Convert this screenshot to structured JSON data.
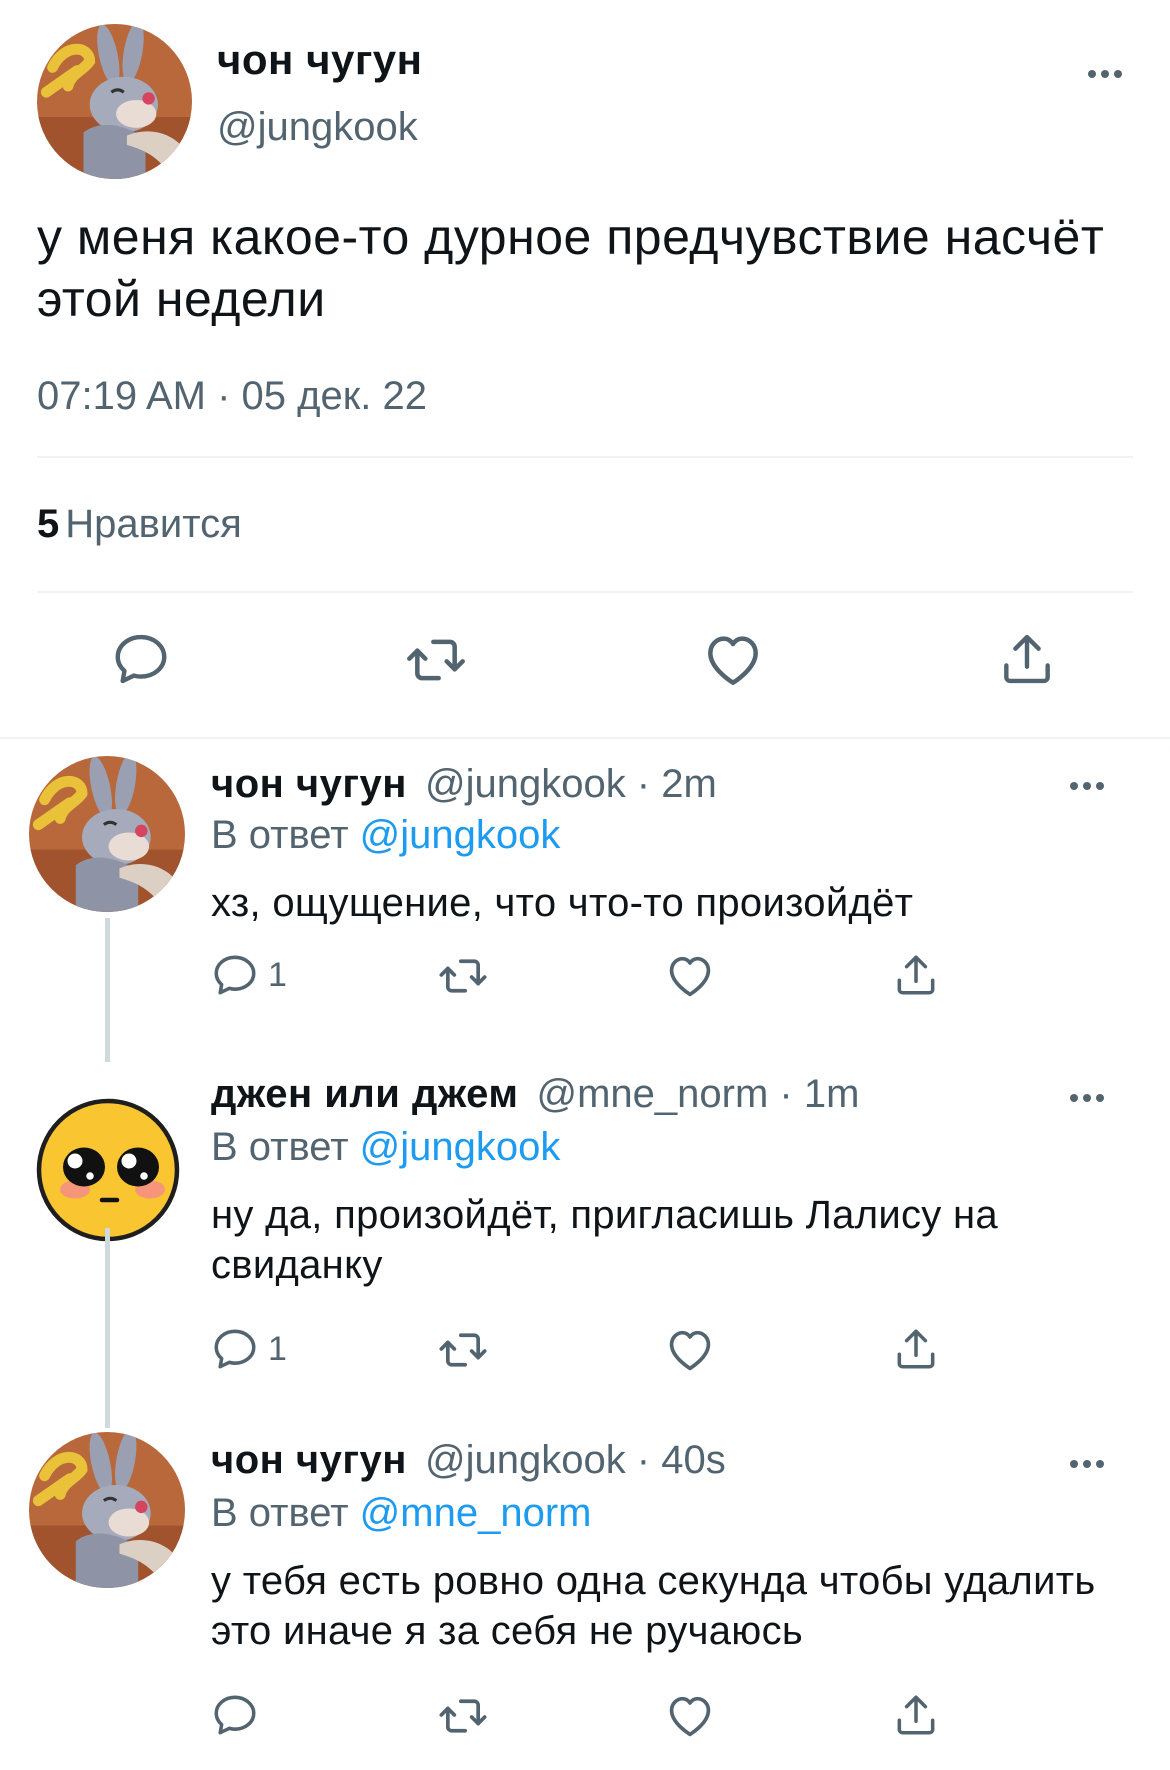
{
  "main_tweet": {
    "author_name": "чон чугун",
    "author_handle": "@jungkook",
    "text": "у меня какое-то дурное предчувствие насчёт этой недели",
    "timestamp": "07:19 AM · 05 дек. 22",
    "like_count": "5",
    "like_label": "Нравится"
  },
  "replies": [
    {
      "author_name": "чон чугун",
      "meta": "@jungkook · 2m",
      "reply_prefix": "В ответ",
      "reply_to": "@jungkook",
      "text": "хз, ощущение, что что-то произойдёт",
      "reply_count": "1"
    },
    {
      "author_name": "джен или джем",
      "meta": "@mne_norm · 1m",
      "reply_prefix": "В ответ",
      "reply_to": "@jungkook",
      "text": "ну да, произойдёт, пригласишь Лалису на свиданку",
      "reply_count": "1"
    },
    {
      "author_name": "чон чугун",
      "meta": "@jungkook · 40s",
      "reply_prefix": "В ответ",
      "reply_to": "@mne_norm",
      "text": "у тебя есть ровно одна секунда чтобы удалить это иначе я за себя не ручаюсь",
      "reply_count": ""
    }
  ],
  "icons": {
    "reply": "speech-bubble-icon",
    "retweet": "retweet-icon",
    "like": "heart-icon",
    "share": "share-upload-icon",
    "more": "more-dots-icon"
  },
  "colors": {
    "text": "#0f1419",
    "muted": "#536471",
    "link": "#1d9bf0",
    "divider": "#eff3f4",
    "thread_line": "#cfd9de"
  }
}
